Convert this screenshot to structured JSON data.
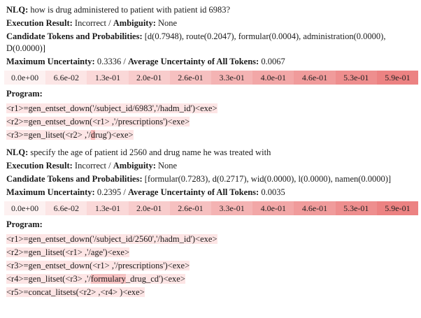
{
  "labels": {
    "nlq": "NLQ:",
    "exec": "Execution Result:",
    "ambiguity": "Ambiguity:",
    "candidates": "Candidate Tokens and Probabilities:",
    "max_unc": "Maximum Uncertainty:",
    "avg_unc": "Average Uncertainty of All Tokens:",
    "program": "Program:",
    "separator": " / "
  },
  "scale": {
    "values": [
      "0.0e+00",
      "6.6e-02",
      "1.3e-01",
      "2.0e-01",
      "2.6e-01",
      "3.3e-01",
      "4.0e-01",
      "4.6e-01",
      "5.3e-01",
      "5.9e-01"
    ],
    "colors": [
      "#fdf1f1",
      "#fce5e5",
      "#fad8d8",
      "#f8cccc",
      "#f6c0c0",
      "#f4b3b3",
      "#f2a7a7",
      "#f09b9b",
      "#ee8e8e",
      "#ec8282"
    ]
  },
  "examples": [
    {
      "nlq": "how is drug administered to patient with patient id 6983?",
      "exec_result": "Incorrect",
      "ambiguity": "None",
      "candidates_line1": "[d(0.7948), route(0.2047), formular(0.0004), administration(0.0000),",
      "candidates_line2": "D(0.0000)]",
      "max_uncertainty": "0.3336",
      "avg_uncertainty": "0.0067",
      "program": [
        {
          "tokens": [
            {
              "t": "<r1>=gen_entset_down('/subject_id/6983','/hadm_id')<exe>",
              "c": "#fde5e5"
            }
          ]
        },
        {
          "tokens": [
            {
              "t": "<r2>=gen_entset_down(<r1> ,'/prescriptions')<exe>",
              "c": "#fde5e5"
            }
          ]
        },
        {
          "tokens": [
            {
              "t": "<r3>=gen_litset(<r2> ,'/",
              "c": "#fde5e5"
            },
            {
              "t": "d",
              "c": "#f6b7b7"
            },
            {
              "t": "rug')<exe>",
              "c": "#fde5e5"
            }
          ]
        }
      ]
    },
    {
      "nlq": "specify the age of patient id 2560 and drug name he was treated with",
      "exec_result": "Incorrect",
      "ambiguity": "None",
      "candidates_line1": "[formular(0.7283), d(0.2717), wid(0.0000), l(0.0000), namen(0.0000)]",
      "candidates_line2": "",
      "max_uncertainty": "0.2395",
      "avg_uncertainty": "0.0035",
      "program": [
        {
          "tokens": [
            {
              "t": "<r1>=gen_entset_down('/subject_id/2560','/hadm_id')<exe>",
              "c": "#fde5e5"
            }
          ]
        },
        {
          "tokens": [
            {
              "t": "<r2>=gen_litset(<r1> ,'/age')<exe>",
              "c": "#fde5e5"
            }
          ]
        },
        {
          "tokens": [
            {
              "t": "<r3>=gen_entset_down(<r1> ,'/prescriptions')<exe>",
              "c": "#fde5e5"
            }
          ]
        },
        {
          "tokens": [
            {
              "t": "<r4>=gen_litset(<r3> ,'/",
              "c": "#fde5e5"
            },
            {
              "t": "formulary",
              "c": "#f6c2c2"
            },
            {
              "t": "_drug_cd')<exe>",
              "c": "#fde5e5"
            }
          ]
        },
        {
          "tokens": [
            {
              "t": "<r5>=concat_litsets(<r2> ,<r4> )<exe>",
              "c": "#fde5e5"
            }
          ]
        }
      ]
    }
  ]
}
